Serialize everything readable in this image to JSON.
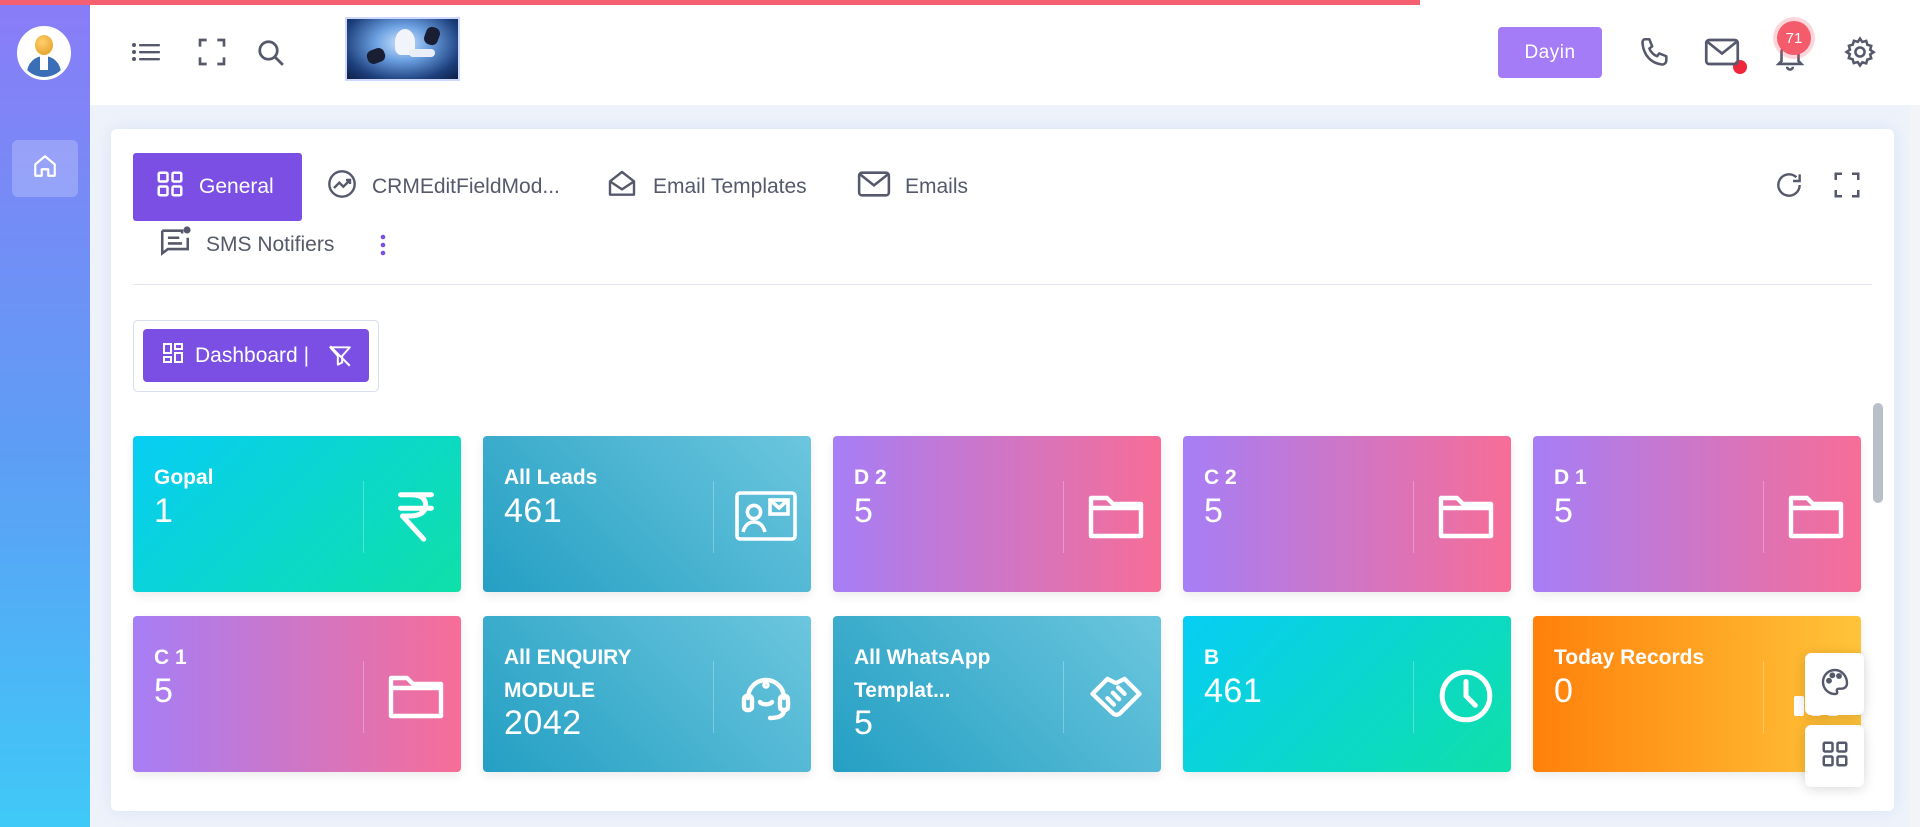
{
  "header": {
    "dayin_label": "Dayin",
    "notification_count": "71",
    "icons": [
      "menu-list-icon",
      "fullscreen-icon",
      "search-icon",
      "phone-icon",
      "mail-icon",
      "bell-icon",
      "gear-icon"
    ]
  },
  "sidebar": {
    "items": [
      {
        "icon": "home-icon"
      }
    ]
  },
  "tabs": [
    {
      "label": "General",
      "icon": "grid-icon",
      "active": true
    },
    {
      "label": "CRMEditFieldMod...",
      "icon": "trend-icon"
    },
    {
      "label": "Email Templates",
      "icon": "mail-open-icon"
    },
    {
      "label": "Emails",
      "icon": "mail-icon"
    },
    {
      "label": "SMS Notifiers",
      "icon": "message-icon"
    }
  ],
  "dashboard": {
    "label": "Dashboard |"
  },
  "tiles": [
    {
      "label": "Gopal",
      "value": "1",
      "icon": "rupee-icon",
      "style": "mint"
    },
    {
      "label": "All Leads",
      "value": "461",
      "icon": "contact-card-icon",
      "style": "teal"
    },
    {
      "label": "D 2",
      "value": "5",
      "icon": "folder-icon",
      "style": "pink"
    },
    {
      "label": "C 2",
      "value": "5",
      "icon": "folder-icon",
      "style": "pink"
    },
    {
      "label": "D 1",
      "value": "5",
      "icon": "folder-icon",
      "style": "pink"
    },
    {
      "label": "C 1",
      "value": "5",
      "icon": "folder-icon",
      "style": "pink"
    },
    {
      "label": "All ENQUIRY MODULE",
      "value": "2042",
      "icon": "headset-icon",
      "style": "teal"
    },
    {
      "label": "All WhatsApp Templat...",
      "value": "5",
      "icon": "handshake-icon",
      "style": "teal"
    },
    {
      "label": "B",
      "value": "461",
      "icon": "clock-icon",
      "style": "mint"
    },
    {
      "label": "Today Records",
      "value": "0",
      "icon": "bar-chart-icon",
      "style": "orange"
    }
  ],
  "colors": {
    "accent": "#7b4fe4",
    "dayin_button": "#a57cf7",
    "badge": "#f45c6b",
    "progress_line": "#f4606f"
  }
}
